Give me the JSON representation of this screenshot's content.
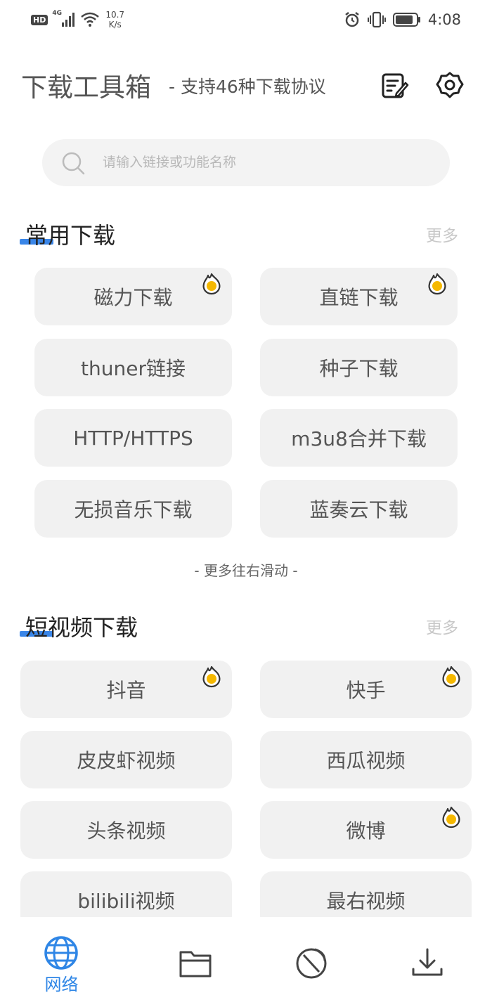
{
  "status": {
    "hd": "HD",
    "network": "4G",
    "speed_value": "10.7",
    "speed_unit": "K/s",
    "time": "4:08"
  },
  "header": {
    "title": "下载工具箱",
    "subtitle": "- 支持46种下载协议",
    "edit_icon": "edit-note-icon",
    "settings_icon": "gear-icon"
  },
  "search": {
    "placeholder": "请输入链接或功能名称",
    "icon": "search-icon"
  },
  "sections": {
    "common": {
      "title": "常用下载",
      "more": "更多",
      "items": [
        {
          "label": "磁力下载",
          "hot": true
        },
        {
          "label": "直链下载",
          "hot": true
        },
        {
          "label": "thuner链接",
          "hot": false
        },
        {
          "label": "种子下载",
          "hot": false
        },
        {
          "label": "HTTP/HTTPS",
          "hot": false
        },
        {
          "label": "m3u8合并下载",
          "hot": false
        },
        {
          "label": "无损音乐下载",
          "hot": false
        },
        {
          "label": "蓝奏云下载",
          "hot": false
        }
      ],
      "hint": "- 更多往右滑动 -"
    },
    "video": {
      "title": "短视频下载",
      "more": "更多",
      "items": [
        {
          "label": "抖音",
          "hot": true
        },
        {
          "label": "快手",
          "hot": true
        },
        {
          "label": "皮皮虾视频",
          "hot": false
        },
        {
          "label": "西瓜视频",
          "hot": false
        },
        {
          "label": "头条视频",
          "hot": false
        },
        {
          "label": "微博",
          "hot": true
        },
        {
          "label": "bilibili视频",
          "hot": false
        },
        {
          "label": "最右视频",
          "hot": false
        }
      ]
    }
  },
  "bottom_nav": {
    "items": [
      {
        "label": "网络",
        "icon": "globe-icon",
        "active": true
      },
      {
        "label": "",
        "icon": "folder-icon",
        "active": false
      },
      {
        "label": "",
        "icon": "satellite-dish-icon",
        "active": false
      },
      {
        "label": "",
        "icon": "download-icon",
        "active": false
      }
    ]
  },
  "colors": {
    "accent": "#2f86e6",
    "section_bar": "#3a86e8",
    "card_bg": "#f1f1f1",
    "hot_flame": "#f5b800"
  }
}
